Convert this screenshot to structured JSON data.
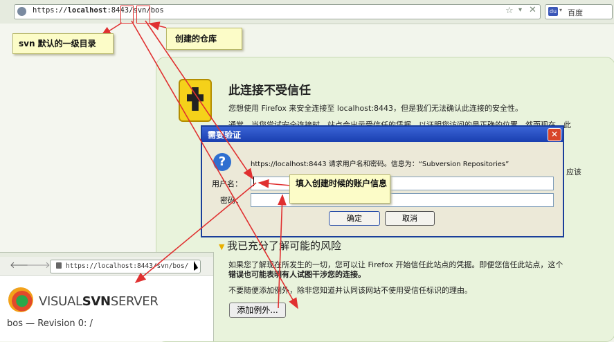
{
  "browser": {
    "url_parts": [
      "https://",
      "localhost",
      ":8443/svn/bos"
    ],
    "search_placeholder": "百度"
  },
  "cert_page": {
    "title": "此连接不受信任",
    "line1": "您想使用 Firefox 来安全连接至 localhost:8443，但是我们无法确认此连接的安全性。",
    "line2": "通常，当您尝试安全连接时，站点会出示受信任的凭据，以证明您访问的是正确的位置。然而现在，此",
    "frag_right_1": "此",
    "frag_right_2": "应该",
    "risk_title": "我已充分了解可能的风险",
    "risk_line1": "如果您了解现在所发生的一切，您可以让 Firefox 开始信任此站点的凭据。即便您信任此站点，这个",
    "risk_line2": "错误也可能表明有人试图干涉您的连接。",
    "risk_line3": "不要随便添加例外，除非您知道并认同该网站不使用受信任标识的理由。",
    "add_exception": "添加例外..."
  },
  "dialog": {
    "title": "需要验证",
    "close": "✕",
    "message": "https://localhost:8443 请求用户名和密码。信息为：“Subversion Repositories”",
    "username_label": "用户名：",
    "username_value": "",
    "password_label": "密码：",
    "password_value": "",
    "ok": "确定",
    "cancel": "取消"
  },
  "callouts": {
    "svn_dir": "svn 默认的一级目录",
    "repo": "创建的仓库",
    "account": "填入创建时候的账户信息"
  },
  "inset_browser": {
    "url": "https://localhost:8443/svn/bos/",
    "brand_prefix": "VISUAL",
    "brand_svn": "SVN",
    "brand_suffix": "SERVER",
    "revision": "bos — Revision 0: /"
  },
  "colors": {
    "annotation_red": "#e03030",
    "callout_bg": "#fcfcc8",
    "dialog_blue": "#1a3e9a"
  }
}
